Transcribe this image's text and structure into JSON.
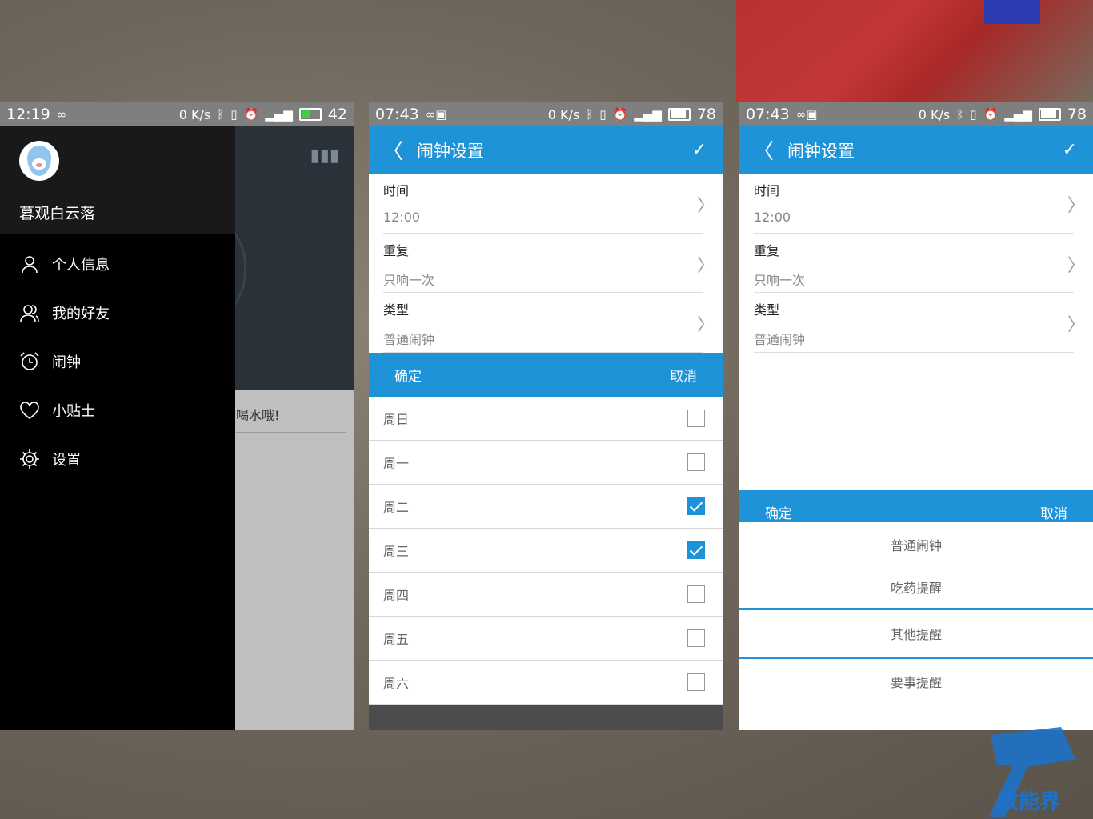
{
  "phone1": {
    "status": {
      "time": "12:19",
      "signal_text": "0 K/s",
      "battery": "42"
    },
    "drawer": {
      "username": "暮观白云落",
      "menu": [
        {
          "label": "个人信息",
          "icon": "person-icon"
        },
        {
          "label": "我的好友",
          "icon": "friends-icon"
        },
        {
          "label": "闹钟",
          "icon": "alarm-icon"
        },
        {
          "label": "小贴士",
          "icon": "heart-icon"
        },
        {
          "label": "设置",
          "icon": "gear-icon"
        }
      ]
    },
    "behind_text": "喝水哦!"
  },
  "phone2": {
    "status": {
      "time": "07:43",
      "signal_text": "0 K/s",
      "battery": "78"
    },
    "appbar": {
      "title": "闹钟设置"
    },
    "form": [
      {
        "label": "时间",
        "value": "12:00"
      },
      {
        "label": "重复",
        "value": "只响一次"
      },
      {
        "label": "类型",
        "value": "普通闹钟"
      }
    ],
    "dialog": {
      "confirm": "确定",
      "cancel": "取消",
      "days": [
        {
          "label": "周日",
          "checked": false
        },
        {
          "label": "周一",
          "checked": false
        },
        {
          "label": "周二",
          "checked": true
        },
        {
          "label": "周三",
          "checked": true
        },
        {
          "label": "周四",
          "checked": false
        },
        {
          "label": "周五",
          "checked": false
        },
        {
          "label": "周六",
          "checked": false
        }
      ]
    }
  },
  "phone3": {
    "status": {
      "time": "07:43",
      "signal_text": "0 K/s",
      "battery": "78"
    },
    "appbar": {
      "title": "闹钟设置"
    },
    "form": [
      {
        "label": "时间",
        "value": "12:00"
      },
      {
        "label": "重复",
        "value": "只响一次"
      },
      {
        "label": "类型",
        "value": "普通闹钟"
      }
    ],
    "dialog": {
      "confirm": "确定",
      "cancel": "取消",
      "options": [
        "普通闹钟",
        "吃药提醒",
        "其他提醒",
        "要事提醒"
      ],
      "selected": "其他提醒"
    }
  },
  "watermark": {
    "text": "致能界"
  },
  "colors": {
    "accent": "#1e93d8"
  }
}
